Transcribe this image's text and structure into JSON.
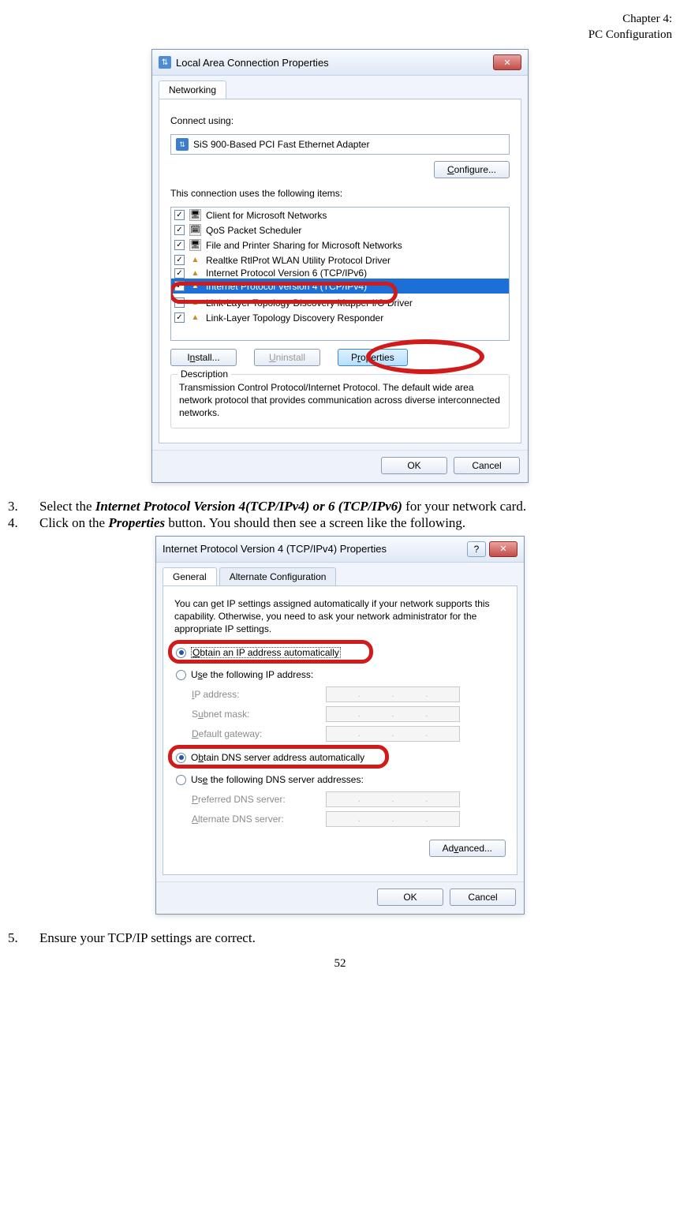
{
  "header": {
    "line1": "Chapter 4:",
    "line2": "PC Configuration"
  },
  "dialog1": {
    "title": "Local Area Connection Properties",
    "tab": "Networking",
    "connect_label": "Connect using:",
    "adapter": "SiS 900-Based PCI Fast Ethernet Adapter",
    "configure_btn": "Configure...",
    "items_label": "This connection uses the following items:",
    "items": [
      "Client for Microsoft Networks",
      "QoS Packet Scheduler",
      "File and Printer Sharing for Microsoft Networks",
      "Realtke RtlProt WLAN Utility Protocol Driver",
      "Internet Protocol Version 6 (TCP/IPv6)",
      "Internet Protocol Version 4 (TCP/IPv4)",
      "Link-Layer Topology Discovery Mapper I/O Driver",
      "Link-Layer Topology Discovery Responder"
    ],
    "install_btn": "Install...",
    "uninstall_btn": "Uninstall",
    "properties_btn": "Properties",
    "desc_label": "Description",
    "desc_text": "Transmission Control Protocol/Internet Protocol. The default wide area network protocol that provides communication across diverse interconnected networks.",
    "ok": "OK",
    "cancel": "Cancel"
  },
  "steps": {
    "s3_num": "3.",
    "s3_a": "Select the ",
    "s3_b": "Internet Protocol Version 4(TCP/IPv4) or 6 (TCP/IPv6)",
    "s3_c": " for your network card.",
    "s4_num": "4.",
    "s4_a": "Click on the ",
    "s4_b": "Properties",
    "s4_c": " button. You should then see a screen like the following.",
    "s5_num": "5.",
    "s5": "Ensure your TCP/IP settings are correct."
  },
  "dialog2": {
    "title": "Internet Protocol Version 4 (TCP/IPv4) Properties",
    "tab1": "General",
    "tab2": "Alternate Configuration",
    "intro": "You can get IP settings assigned automatically if your network supports this capability. Otherwise, you need to ask your network administrator for the appropriate IP settings.",
    "r1": "Obtain an IP address automatically",
    "r2": "Use the following IP address:",
    "ip_lbl": "IP address:",
    "sm_lbl": "Subnet mask:",
    "gw_lbl": "Default gateway:",
    "r3": "Obtain DNS server address automatically",
    "r4": "Use the following DNS server addresses:",
    "pdns_lbl": "Preferred DNS server:",
    "adns_lbl": "Alternate DNS server:",
    "advanced_btn": "Advanced...",
    "ok": "OK",
    "cancel": "Cancel"
  },
  "page_number": "52"
}
